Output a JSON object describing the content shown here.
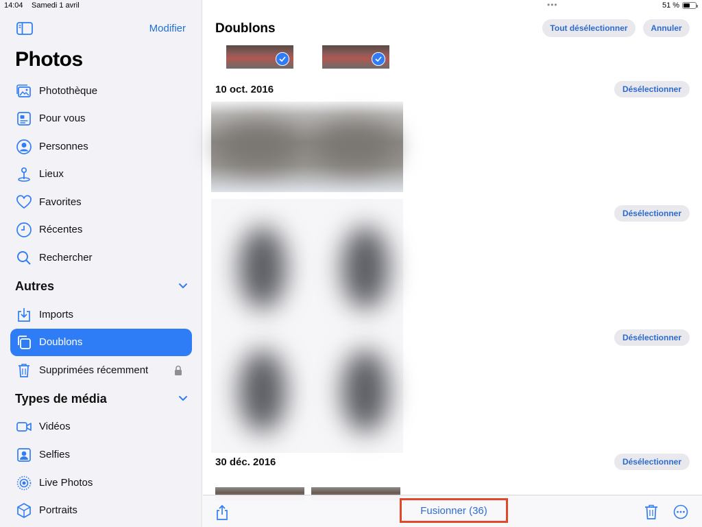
{
  "status": {
    "time": "14:04",
    "date": "Samedi 1 avril",
    "battery_pct": "51 %",
    "battery_level": 0.51
  },
  "sidebar": {
    "toggle_icon": "sidebar-icon",
    "edit_label": "Modifier",
    "title": "Photos",
    "items": [
      {
        "label": "Photothèque",
        "icon": "photo-library-icon"
      },
      {
        "label": "Pour vous",
        "icon": "for-you-icon"
      },
      {
        "label": "Personnes",
        "icon": "person-icon"
      },
      {
        "label": "Lieux",
        "icon": "map-pin-icon"
      },
      {
        "label": "Favorites",
        "icon": "heart-icon"
      },
      {
        "label": "Récentes",
        "icon": "clock-icon"
      },
      {
        "label": "Rechercher",
        "icon": "search-icon"
      }
    ],
    "others": {
      "heading": "Autres",
      "items": [
        {
          "label": "Imports",
          "icon": "import-icon"
        },
        {
          "label": "Doublons",
          "icon": "duplicates-icon",
          "selected": true
        },
        {
          "label": "Supprimées récemment",
          "icon": "trash-icon",
          "locked": true
        }
      ]
    },
    "media_types": {
      "heading": "Types de média",
      "items": [
        {
          "label": "Vidéos",
          "icon": "video-icon"
        },
        {
          "label": "Selfies",
          "icon": "selfie-icon"
        },
        {
          "label": "Live Photos",
          "icon": "live-photo-icon"
        },
        {
          "label": "Portraits",
          "icon": "cube-icon"
        }
      ]
    },
    "accent_color": "#2f7df6"
  },
  "main": {
    "title": "Doublons",
    "deselect_all_label": "Tout désélectionner",
    "cancel_label": "Annuler",
    "deselect_label": "Désélectionner",
    "groups": [
      {
        "date": "10 oct. 2016"
      },
      {
        "date": "30 déc. 2016"
      }
    ]
  },
  "toolbar": {
    "share_icon": "share-icon",
    "merge_label": "Fusionner (36)",
    "trash_icon": "trash-icon",
    "more_icon": "more-icon",
    "highlight_color": "#e0472c"
  }
}
